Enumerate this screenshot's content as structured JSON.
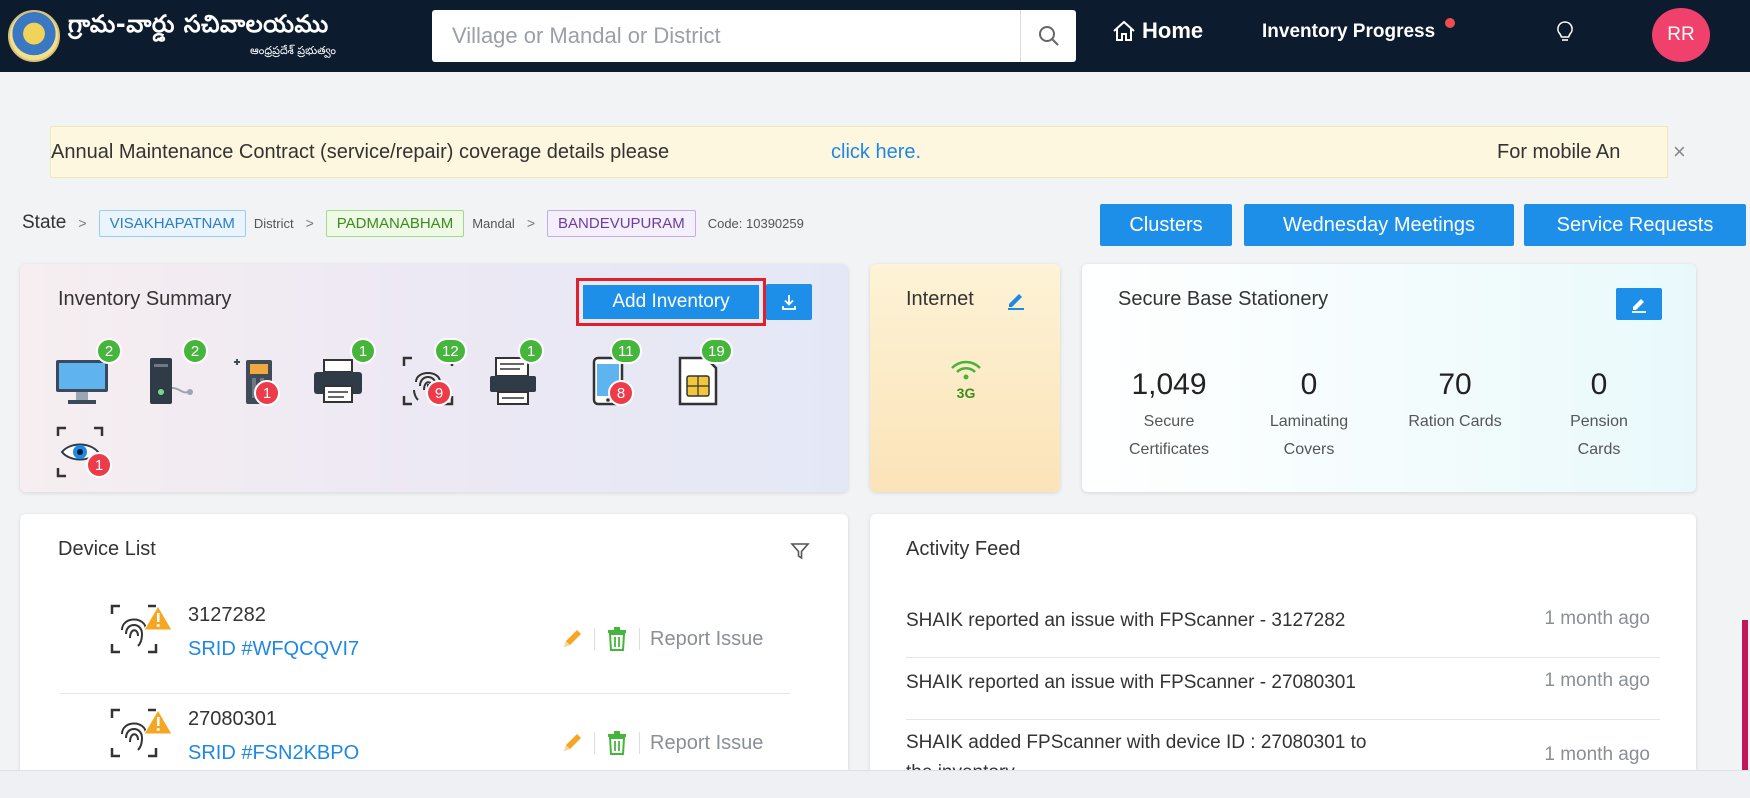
{
  "header": {
    "logo_title": "గ్రామ-వార్డు సచివాలయము",
    "logo_subtitle": "ఆంధ్రప్రదేశ్ ప్రభుత్వం",
    "search_placeholder": "Village or Mandal or District",
    "home_label": "Home",
    "progress_label": "Inventory Progress",
    "avatar_initials": "RR"
  },
  "notice": {
    "text": "Annual Maintenance Contract (service/repair) coverage details please",
    "link": "click here.",
    "right_text": "For mobile Anr",
    "close": "×"
  },
  "breadcrumb": {
    "state_label": "State",
    "district_value": "VISAKHAPATNAM",
    "district_label": "District",
    "mandal_value": "PADMANABHAM",
    "mandal_label": "Mandal",
    "village_value": "BANDEVUPURAM",
    "code": "Code: 10390259"
  },
  "actions": {
    "clusters": "Clusters",
    "meetings": "Wednesday Meetings",
    "service": "Service Requests"
  },
  "inventory": {
    "title": "Inventory Summary",
    "add_label": "Add Inventory",
    "items": [
      {
        "icon": "monitor-icon",
        "green": "2",
        "red": ""
      },
      {
        "icon": "cpu-icon",
        "green": "2",
        "red": ""
      },
      {
        "icon": "ups-icon",
        "green": "",
        "red": "1"
      },
      {
        "icon": "printer-icon",
        "green": "1",
        "red": ""
      },
      {
        "icon": "fingerprint-icon",
        "green": "12",
        "red": "9"
      },
      {
        "icon": "scanner-icon",
        "green": "1",
        "red": ""
      },
      {
        "icon": "mobile-icon",
        "green": "11",
        "red": "8"
      },
      {
        "icon": "sim-icon",
        "green": "19",
        "red": ""
      },
      {
        "icon": "iris-icon",
        "green": "",
        "red": "1"
      }
    ]
  },
  "internet": {
    "title": "Internet",
    "network": "3G"
  },
  "stationery": {
    "title": "Secure Base Stationery",
    "stats": [
      {
        "value": "1,049",
        "line1": "Secure",
        "line2": "Certificates"
      },
      {
        "value": "0",
        "line1": "Laminating",
        "line2": "Covers"
      },
      {
        "value": "70",
        "line1": "Ration Cards",
        "line2": ""
      },
      {
        "value": "0",
        "line1": "Pension",
        "line2": "Cards"
      }
    ]
  },
  "device_list": {
    "title": "Device List",
    "report_label": "Report Issue",
    "rows": [
      {
        "id": "3127282",
        "srid": "SRID #WFQCQVI7"
      },
      {
        "id": "27080301",
        "srid": "SRID #FSN2KBPO"
      }
    ]
  },
  "activity": {
    "title": "Activity Feed",
    "rows": [
      {
        "text": "SHAIK reported an issue with FPScanner - 3127282",
        "time": "1 month ago"
      },
      {
        "text": "SHAIK reported an issue with FPScanner - 27080301",
        "time": "1 month ago"
      },
      {
        "text": "SHAIK added FPScanner with device ID : 27080301 to",
        "text2": "the inventory",
        "time": "1 month ago"
      }
    ]
  },
  "colors": {
    "navbar": "#0d1b2e",
    "primary": "#1e8fe8",
    "badge_green": "#46b53b",
    "badge_red": "#ee3b4a",
    "avatar": "#f0416c"
  }
}
